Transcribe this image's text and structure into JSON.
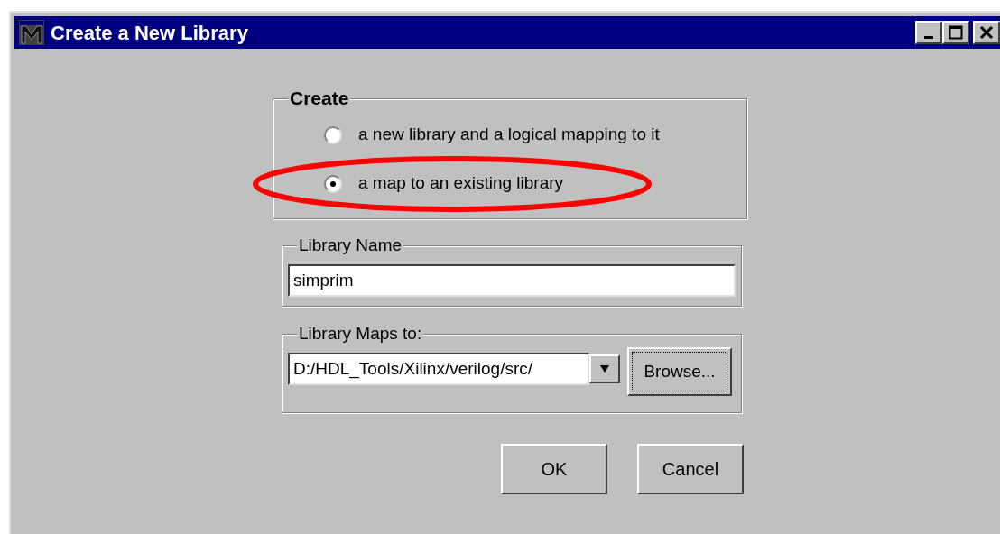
{
  "window": {
    "title": "Create a New Library",
    "controls": [
      {
        "kind": "minimize"
      },
      {
        "kind": "maximize"
      },
      {
        "kind": "close"
      }
    ]
  },
  "create_group": {
    "title": "Create",
    "options": [
      {
        "label": "a new library and a logical mapping to it",
        "selected": false,
        "highlighted": false
      },
      {
        "label": "a map to an existing library",
        "selected": true,
        "highlighted": true
      }
    ]
  },
  "library_name": {
    "title": "Library Name",
    "value": "simprim"
  },
  "library_maps_to": {
    "title": "Library Maps to:",
    "value": "D:/HDL_Tools/Xilinx/verilog/src/",
    "browse_button": "Browse..."
  },
  "buttons": [
    "OK",
    "Cancel"
  ]
}
